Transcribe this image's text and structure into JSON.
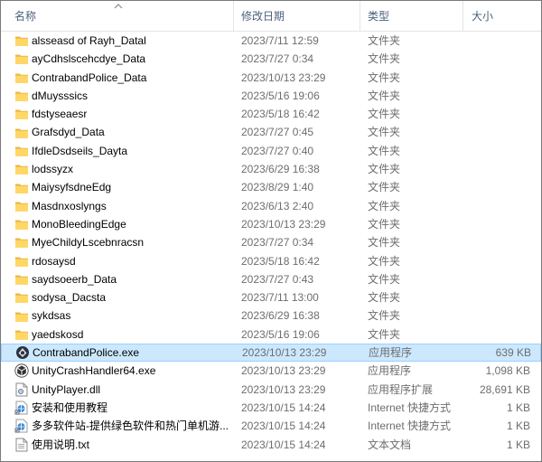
{
  "columns": {
    "name": "名称",
    "date": "修改日期",
    "type": "类型",
    "size": "大小"
  },
  "rows": [
    {
      "icon": "folder-icon",
      "name": "alsseasd of Rayh_Datal",
      "date": "2023/7/11 12:59",
      "type": "文件夹",
      "size": ""
    },
    {
      "icon": "folder-icon",
      "name": "ayCdhslscehcdye_Data",
      "date": "2023/7/27 0:34",
      "type": "文件夹",
      "size": ""
    },
    {
      "icon": "folder-icon",
      "name": "ContrabandPolice_Data",
      "date": "2023/10/13 23:29",
      "type": "文件夹",
      "size": ""
    },
    {
      "icon": "folder-icon",
      "name": "dMuysssics",
      "date": "2023/5/16 19:06",
      "type": "文件夹",
      "size": ""
    },
    {
      "icon": "folder-icon",
      "name": "fdstyseaesr",
      "date": "2023/5/18 16:42",
      "type": "文件夹",
      "size": ""
    },
    {
      "icon": "folder-icon",
      "name": "Grafsdyd_Data",
      "date": "2023/7/27 0:45",
      "type": "文件夹",
      "size": ""
    },
    {
      "icon": "folder-icon",
      "name": "IfdleDsdseils_Dayta",
      "date": "2023/7/27 0:40",
      "type": "文件夹",
      "size": ""
    },
    {
      "icon": "folder-icon",
      "name": "lodssyzx",
      "date": "2023/6/29 16:38",
      "type": "文件夹",
      "size": ""
    },
    {
      "icon": "folder-icon",
      "name": "MaiysyfsdneEdg",
      "date": "2023/8/29 1:40",
      "type": "文件夹",
      "size": ""
    },
    {
      "icon": "folder-icon",
      "name": "Masdnxoslyngs",
      "date": "2023/6/13 2:40",
      "type": "文件夹",
      "size": ""
    },
    {
      "icon": "folder-icon",
      "name": "MonoBleedingEdge",
      "date": "2023/10/13 23:29",
      "type": "文件夹",
      "size": ""
    },
    {
      "icon": "folder-icon",
      "name": "MyeChildyLscebnracsn",
      "date": "2023/7/27 0:34",
      "type": "文件夹",
      "size": ""
    },
    {
      "icon": "folder-icon",
      "name": "rdosaysd",
      "date": "2023/5/18 16:42",
      "type": "文件夹",
      "size": ""
    },
    {
      "icon": "folder-icon",
      "name": "saydsoeerb_Data",
      "date": "2023/7/27 0:43",
      "type": "文件夹",
      "size": ""
    },
    {
      "icon": "folder-icon",
      "name": "sodysa_Dacsta",
      "date": "2023/7/11 13:00",
      "type": "文件夹",
      "size": ""
    },
    {
      "icon": "folder-icon",
      "name": "sykdsas",
      "date": "2023/6/29 16:38",
      "type": "文件夹",
      "size": ""
    },
    {
      "icon": "folder-icon",
      "name": "yaedskosd",
      "date": "2023/5/16 19:06",
      "type": "文件夹",
      "size": ""
    },
    {
      "icon": "game-exe-icon",
      "name": "ContrabandPolice.exe",
      "date": "2023/10/13 23:29",
      "type": "应用程序",
      "size": "639 KB",
      "selected": true
    },
    {
      "icon": "unity-icon",
      "name": "UnityCrashHandler64.exe",
      "date": "2023/10/13 23:29",
      "type": "应用程序",
      "size": "1,098 KB"
    },
    {
      "icon": "dll-icon",
      "name": "UnityPlayer.dll",
      "date": "2023/10/13 23:29",
      "type": "应用程序扩展",
      "size": "28,691 KB"
    },
    {
      "icon": "url-shortcut-icon",
      "name": "安装和使用教程",
      "date": "2023/10/15 14:24",
      "type": "Internet 快捷方式",
      "size": "1 KB"
    },
    {
      "icon": "url-shortcut-icon",
      "name": "多多软件站-提供绿色软件和热门单机游...",
      "date": "2023/10/15 14:24",
      "type": "Internet 快捷方式",
      "size": "1 KB"
    },
    {
      "icon": "text-file-icon",
      "name": "使用说明.txt",
      "date": "2023/10/15 14:24",
      "type": "文本文档",
      "size": "1 KB"
    }
  ]
}
